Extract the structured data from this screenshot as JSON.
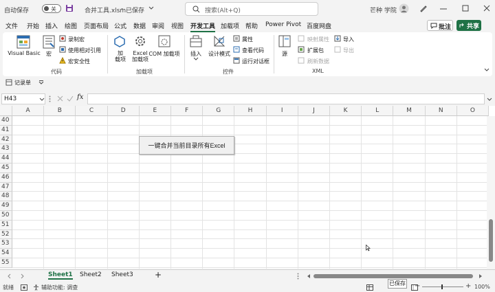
{
  "titlebar": {
    "autosave_label": "自动保存",
    "autosave_state": "关",
    "filename": "合并工具.xlsm",
    "save_status": "已保存",
    "search_placeholder": "搜索(Alt+Q)",
    "user": "芒种 学院"
  },
  "menu": [
    "文件",
    "开始",
    "插入",
    "绘图",
    "页面布局",
    "公式",
    "数据",
    "审阅",
    "视图",
    "开发工具",
    "加载项",
    "帮助",
    "Power Pivot",
    "百度网盘"
  ],
  "menu_active": "开发工具",
  "comment_label": "批注",
  "share_label": "共享",
  "ribbon": {
    "code": {
      "label": "代码",
      "vb": "Visual Basic",
      "macros": "宏",
      "record": "录制宏",
      "relative": "使用相对引用",
      "security": "宏安全性"
    },
    "addins": {
      "label": "加载项",
      "addins": "加\n载项",
      "excel_addins": "Excel\n加载项",
      "com_addins": "COM 加载项"
    },
    "controls": {
      "label": "控件",
      "insert": "插入",
      "design": "设计模式",
      "properties": "属性",
      "view_code": "查看代码",
      "run_dialog": "运行对话框"
    },
    "xml": {
      "label": "XML",
      "source": "源",
      "map_props": "映射属性",
      "expansion": "扩展包",
      "refresh": "刷新数据",
      "import": "导入",
      "export": "导出"
    }
  },
  "quick_access": "记录单",
  "namebox": "H43",
  "formula": "",
  "columns": [
    "A",
    "B",
    "C",
    "D",
    "E",
    "F",
    "G",
    "H",
    "I",
    "J",
    "K",
    "L",
    "M",
    "N",
    "O"
  ],
  "rows": [
    "40",
    "41",
    "42",
    "43",
    "44",
    "45",
    "46",
    "47",
    "48",
    "49",
    "50",
    "51",
    "52",
    "53",
    "54",
    "55"
  ],
  "macro_button": "一键合并当前目录所有Excel",
  "sheets": [
    "Sheet1",
    "Sheet2",
    "Sheet3"
  ],
  "active_sheet": "Sheet1",
  "add_sheet": "+",
  "status": {
    "ready": "就绪",
    "accessibility": "辅助功能: 调查",
    "saved_tooltip": "已保存",
    "zoom": "100%"
  },
  "colors": {
    "accent": "#1e7145"
  }
}
